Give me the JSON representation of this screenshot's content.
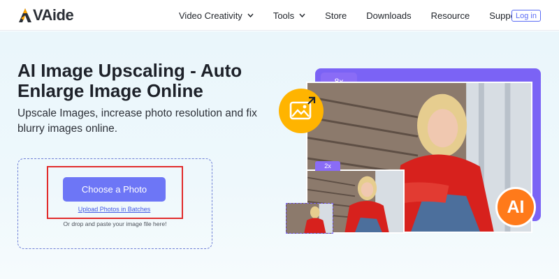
{
  "header": {
    "logo_text": "VAide",
    "nav": [
      {
        "label": "Video Creativity",
        "has_dropdown": true
      },
      {
        "label": "Tools",
        "has_dropdown": true
      },
      {
        "label": "Store",
        "has_dropdown": false
      },
      {
        "label": "Downloads",
        "has_dropdown": false
      },
      {
        "label": "Resource",
        "has_dropdown": false
      },
      {
        "label": "Support",
        "has_dropdown": false
      }
    ],
    "login_label": "Log in"
  },
  "hero": {
    "title": "AI Image Upscaling - Auto Enlarge Image Online",
    "subtitle": "Upscale Images, increase photo resolution and fix blurry images online.",
    "choose_button": "Choose a Photo",
    "batch_link": "Upload Photos in Batches",
    "drop_hint": "Or drop and paste your image file here!"
  },
  "illustration": {
    "tab_large": "8x",
    "tab_mid": "2x",
    "ai_badge": "AI",
    "icons": [
      "image-icon"
    ]
  },
  "colors": {
    "accent": "#6d76f6",
    "purple_panel": "#7b63f5",
    "badge_orange": "#ff7a1a",
    "icon_yellow": "#ffb400",
    "highlight_red": "#e12b2b",
    "hero_bg": "#eaf6fb"
  }
}
